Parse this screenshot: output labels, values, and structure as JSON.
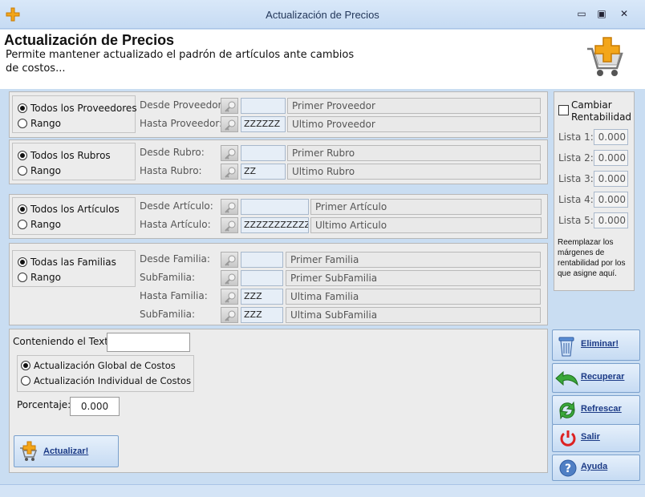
{
  "window": {
    "title": "Actualización de Precios",
    "minimize": "▭",
    "restore": "▣",
    "close": "✕"
  },
  "header": {
    "title": "Actualización de Precios",
    "subtitle": "Permite mantener actualizado el padrón de artículos ante cambios de costos..."
  },
  "proveedores": {
    "opt_all": "Todos los Proveedores",
    "opt_range": "Rango",
    "desde_label": "Desde Proveedor:",
    "desde_code": "",
    "desde_desc": "Primer Proveedor",
    "hasta_label": "Hasta Proveedor:",
    "hasta_code": "ZZZZZZ",
    "hasta_desc": "Ultimo Proveedor"
  },
  "rubros": {
    "opt_all": "Todos los Rubros",
    "opt_range": "Rango",
    "desde_label": "Desde Rubro:",
    "desde_code": "",
    "desde_desc": "Primer Rubro",
    "hasta_label": "Hasta Rubro:",
    "hasta_code": "ZZ",
    "hasta_desc": "Ultimo Rubro"
  },
  "articulos": {
    "opt_all": "Todos los Artículos",
    "opt_range": "Rango",
    "desde_label": "Desde Artículo:",
    "desde_code": "",
    "desde_desc": "Primer Artículo",
    "hasta_label": "Hasta Artículo:",
    "hasta_code": "ZZZZZZZZZZZZ",
    "hasta_desc": "Ultimo Articulo"
  },
  "familias": {
    "opt_all": "Todas las Familias",
    "opt_range": "Rango",
    "desde_label": "Desde Familia:",
    "desde_code": "",
    "desde_desc": "Primer Familia",
    "sub1_label": "SubFamilia:",
    "sub1_code": "",
    "sub1_desc": "Primer SubFamilia",
    "hasta_label": "Hasta Familia:",
    "hasta_code": "ZZZ",
    "hasta_desc": "Ultima Familia",
    "sub2_label": "SubFamilia:",
    "sub2_code": "ZZZ",
    "sub2_desc": "Ultima SubFamilia"
  },
  "bottom": {
    "text_label": "Conteniendo el Texto:",
    "text_value": "",
    "opt_global": "Actualización Global de Costos",
    "opt_individual": "Actualización Individual de Costos",
    "porcentaje_label": "Porcentaje:",
    "porcentaje_value": "0.000",
    "actualizar": "Actualizar!"
  },
  "rentabilidad": {
    "checkbox_label_1": "Cambiar",
    "checkbox_label_2": "Rentabilidad",
    "listas": [
      {
        "label": "Lista 1:",
        "value": "0.000"
      },
      {
        "label": "Lista 2:",
        "value": "0.000"
      },
      {
        "label": "Lista 3:",
        "value": "0.000"
      },
      {
        "label": "Lista 4:",
        "value": "0.000"
      },
      {
        "label": "Lista 5:",
        "value": "0.000"
      }
    ],
    "note": "Reemplazar los márgenes de rentabilidad por los que asigne aquí."
  },
  "actions": {
    "eliminar": "Eliminar!",
    "recuperar": "Recuperar",
    "refrescar": "Refrescar",
    "salir": "Salir",
    "ayuda": "Ayuda"
  }
}
